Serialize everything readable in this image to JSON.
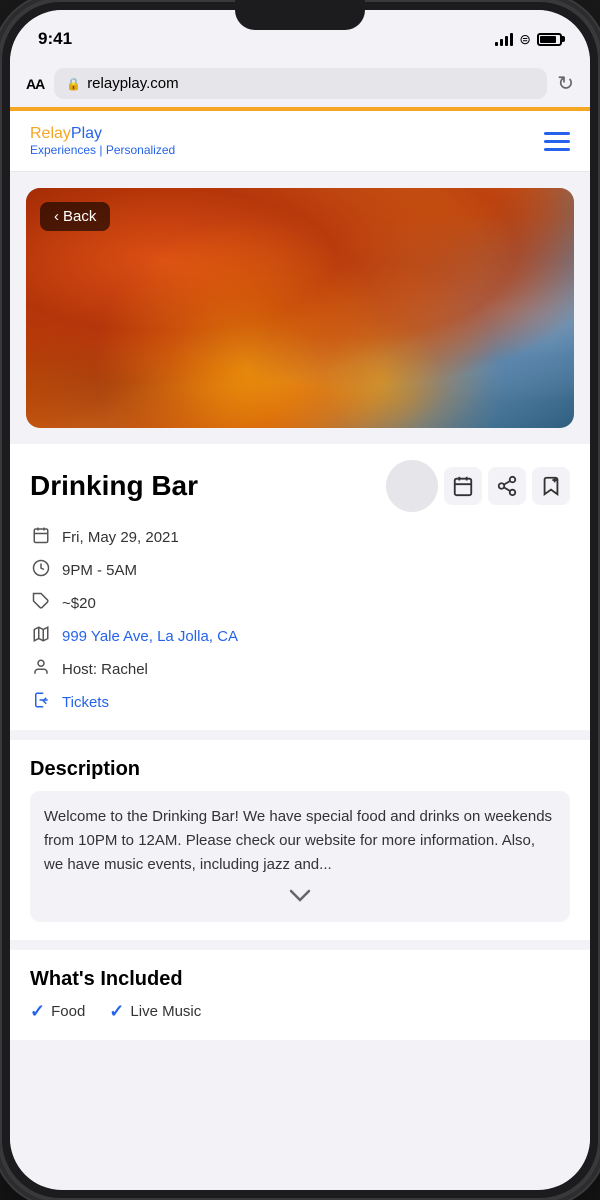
{
  "status_bar": {
    "time": "9:41",
    "signal_label": "signal",
    "wifi_label": "wifi",
    "battery_label": "battery"
  },
  "browser": {
    "aa_label": "AA",
    "url": "relayplay.com",
    "lock_symbol": "🔒",
    "refresh_symbol": "↻"
  },
  "header": {
    "logo_relay": "Relay",
    "logo_play": "Play",
    "logo_subtitle": "Experiences | Personalized",
    "menu_label": "menu"
  },
  "event": {
    "back_button": "Back",
    "back_chevron": "‹",
    "title": "Drinking Bar",
    "date": "Fri, May 29, 2021",
    "time": "9PM - 5AM",
    "price": "~$20",
    "address": "999 Yale Ave, La Jolla, CA",
    "host_label": "Host: Rachel",
    "tickets_label": "Tickets",
    "calendar_icon": "📅",
    "clock_icon": "🕐",
    "price_icon": "🏷",
    "map_icon": "🗺",
    "person_icon": "👤",
    "arrow_icon": "⤷",
    "share_icon": "⎋",
    "bookmark_icon": "🔖",
    "add_symbol": "+",
    "description_title": "Description",
    "description_text": "Welcome to the Drinking Bar! We have special food and drinks on weekends from 10PM to 12AM. Please check our website for more information. Also, we have music events, including jazz and...",
    "chevron_down": "∨",
    "whats_included_title": "What's Included",
    "included_items": [
      {
        "label": "Food",
        "check": "✓"
      },
      {
        "label": "Live Music",
        "check": "✓"
      }
    ]
  }
}
